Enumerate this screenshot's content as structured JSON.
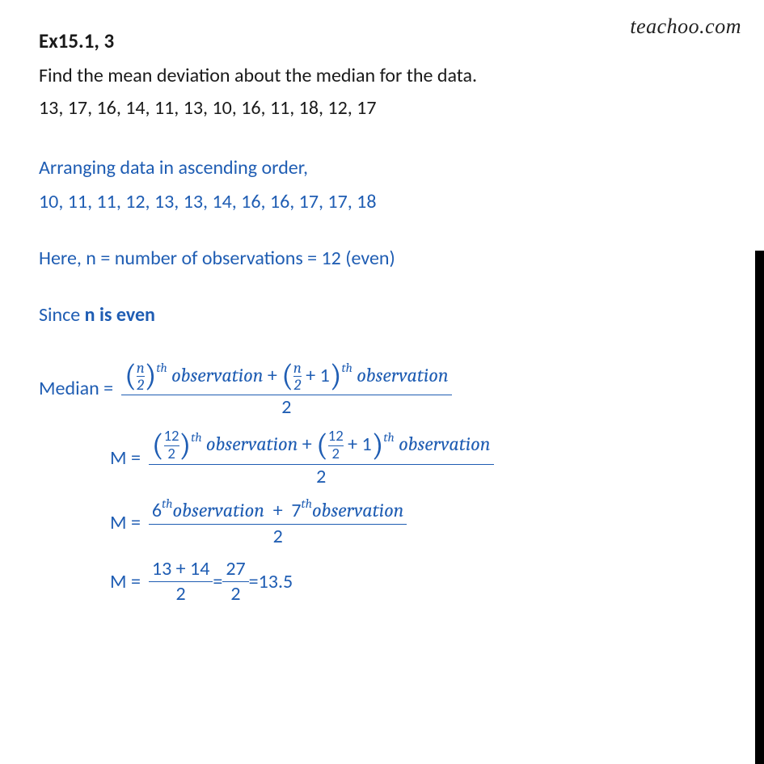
{
  "watermark": "teachoo.com",
  "header": {
    "exercise": "Ex15.1,  3",
    "question": "Find the mean deviation about the median for the data.",
    "data": "13, 17, 16, 14, 11, 13, 10, 16, 11, 18, 12, 17"
  },
  "solution": {
    "arr_label": "Arranging data in ascending order,",
    "arr_data": "10, 11, 11, 12, 13, 13, 14, 16, 16, 17, 17, 18",
    "n_line": "Here, n = number of observations = 12 (even)",
    "since_prefix": "Since ",
    "since_bold": "n is even",
    "median_label": "Median = ",
    "m_label": "M = ",
    "observation": "observation",
    "th": "th",
    "plus1": " + 1",
    "plus": " + ",
    "f1": {
      "n": "n",
      "d": "2",
      "n12": "12"
    },
    "line3": {
      "sixth": "6",
      "seventh": "7"
    },
    "line4": {
      "num1": "13 + 14",
      "den": "2",
      "num2": "27",
      "result": "13.5"
    },
    "two": "2",
    "eq": " = "
  }
}
